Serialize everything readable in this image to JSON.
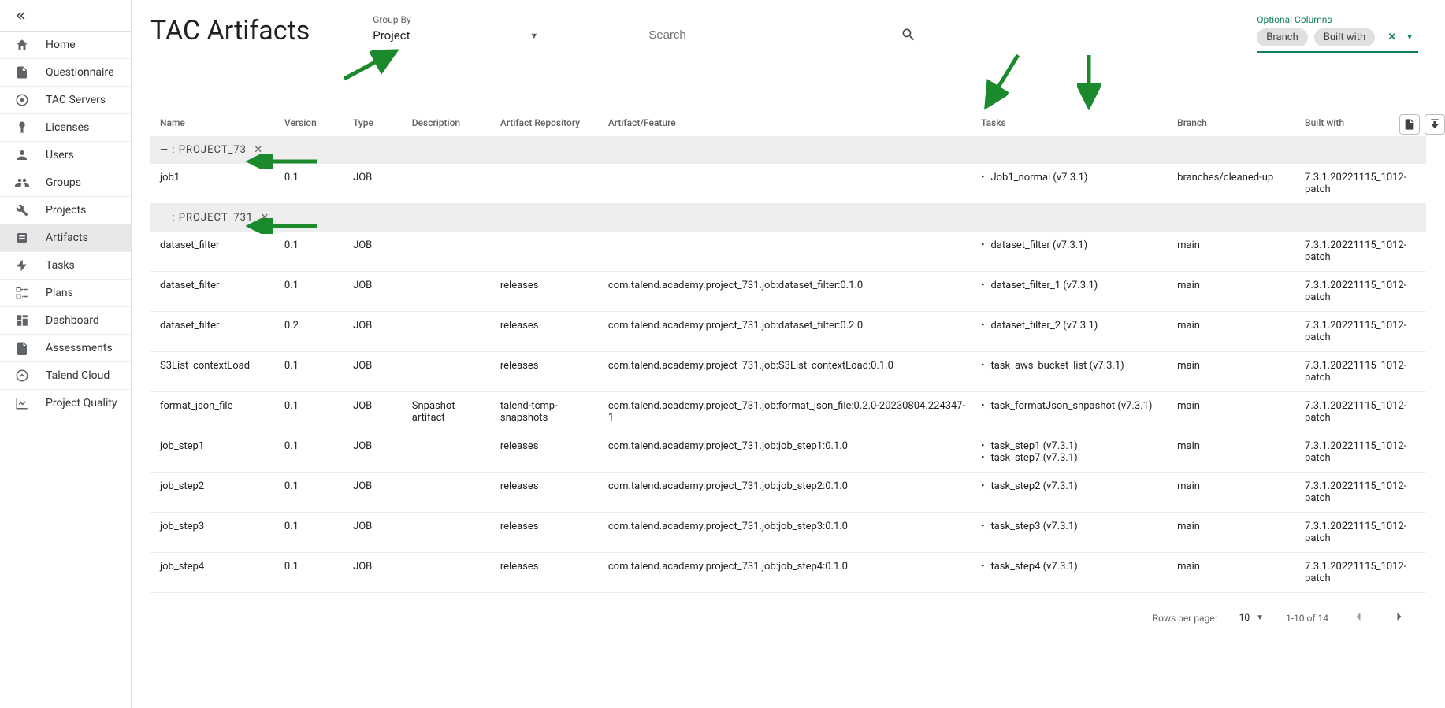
{
  "sidebar": {
    "items": [
      {
        "label": "Home",
        "icon": "home-icon"
      },
      {
        "label": "Questionnaire",
        "icon": "questionnaire-icon"
      },
      {
        "label": "TAC Servers",
        "icon": "server-icon"
      },
      {
        "label": "Licenses",
        "icon": "license-icon"
      },
      {
        "label": "Users",
        "icon": "user-icon"
      },
      {
        "label": "Groups",
        "icon": "groups-icon"
      },
      {
        "label": "Projects",
        "icon": "wrench-icon"
      },
      {
        "label": "Artifacts",
        "icon": "artifact-icon"
      },
      {
        "label": "Tasks",
        "icon": "bolt-icon"
      },
      {
        "label": "Plans",
        "icon": "plan-icon"
      },
      {
        "label": "Dashboard",
        "icon": "dashboard-icon"
      },
      {
        "label": "Assessments",
        "icon": "assessment-icon"
      },
      {
        "label": "Talend Cloud",
        "icon": "cloud-icon"
      },
      {
        "label": "Project Quality",
        "icon": "quality-icon"
      }
    ],
    "active_index": 7
  },
  "header": {
    "title": "TAC Artifacts",
    "groupby_label": "Group By",
    "groupby_value": "Project",
    "search_placeholder": "Search",
    "optional_columns_label": "Optional Columns",
    "chips": [
      "Branch",
      "Built with"
    ]
  },
  "table": {
    "columns": [
      "Name",
      "Version",
      "Type",
      "Description",
      "Artifact Repository",
      "Artifact/Feature",
      "Tasks",
      "Branch",
      "Built with"
    ],
    "groups": [
      {
        "label": "— : PROJECT_73",
        "rows": [
          {
            "name": "job1",
            "version": "0.1",
            "type": "JOB",
            "description": "",
            "repo": "",
            "feature": "",
            "tasks": [
              "Job1_normal (v7.3.1)"
            ],
            "branch": "branches/cleaned-up",
            "built": "7.3.1.20221115_1012-patch"
          }
        ]
      },
      {
        "label": "— : PROJECT_731",
        "rows": [
          {
            "name": "dataset_filter",
            "version": "0.1",
            "type": "JOB",
            "description": "",
            "repo": "",
            "feature": "",
            "tasks": [
              "dataset_filter (v7.3.1)"
            ],
            "branch": "main",
            "built": "7.3.1.20221115_1012-patch"
          },
          {
            "name": "dataset_filter",
            "version": "0.1",
            "type": "JOB",
            "description": "",
            "repo": "releases",
            "feature": "com.talend.academy.project_731.job:dataset_filter:0.1.0",
            "tasks": [
              "dataset_filter_1 (v7.3.1)"
            ],
            "branch": "main",
            "built": "7.3.1.20221115_1012-patch"
          },
          {
            "name": "dataset_filter",
            "version": "0.2",
            "type": "JOB",
            "description": "",
            "repo": "releases",
            "feature": "com.talend.academy.project_731.job:dataset_filter:0.2.0",
            "tasks": [
              "dataset_filter_2 (v7.3.1)"
            ],
            "branch": "main",
            "built": "7.3.1.20221115_1012-patch"
          },
          {
            "name": "S3List_contextLoad",
            "version": "0.1",
            "type": "JOB",
            "description": "",
            "repo": "releases",
            "feature": "com.talend.academy.project_731.job:S3List_contextLoad:0.1.0",
            "tasks": [
              "task_aws_bucket_list (v7.3.1)"
            ],
            "branch": "main",
            "built": "7.3.1.20221115_1012-patch"
          },
          {
            "name": "format_json_file",
            "version": "0.1",
            "type": "JOB",
            "description": "Snpashot artifact",
            "repo": "talend-tcmp-snapshots",
            "feature": "com.talend.academy.project_731.job:format_json_file:0.2.0-20230804.224347-1",
            "tasks": [
              "task_formatJson_snpashot (v7.3.1)"
            ],
            "branch": "main",
            "built": "7.3.1.20221115_1012-patch"
          },
          {
            "name": "job_step1",
            "version": "0.1",
            "type": "JOB",
            "description": "",
            "repo": "releases",
            "feature": "com.talend.academy.project_731.job:job_step1:0.1.0",
            "tasks": [
              "task_step1 (v7.3.1)",
              "task_step7 (v7.3.1)"
            ],
            "branch": "main",
            "built": "7.3.1.20221115_1012-patch"
          },
          {
            "name": "job_step2",
            "version": "0.1",
            "type": "JOB",
            "description": "",
            "repo": "releases",
            "feature": "com.talend.academy.project_731.job:job_step2:0.1.0",
            "tasks": [
              "task_step2 (v7.3.1)"
            ],
            "branch": "main",
            "built": "7.3.1.20221115_1012-patch"
          },
          {
            "name": "job_step3",
            "version": "0.1",
            "type": "JOB",
            "description": "",
            "repo": "releases",
            "feature": "com.talend.academy.project_731.job:job_step3:0.1.0",
            "tasks": [
              "task_step3 (v7.3.1)"
            ],
            "branch": "main",
            "built": "7.3.1.20221115_1012-patch"
          },
          {
            "name": "job_step4",
            "version": "0.1",
            "type": "JOB",
            "description": "",
            "repo": "releases",
            "feature": "com.talend.academy.project_731.job:job_step4:0.1.0",
            "tasks": [
              "task_step4 (v7.3.1)"
            ],
            "branch": "main",
            "built": "7.3.1.20221115_1012-patch"
          }
        ]
      }
    ]
  },
  "pagination": {
    "rows_per_page_label": "Rows per page:",
    "rows_per_page_value": "10",
    "range": "1-10 of 14"
  }
}
